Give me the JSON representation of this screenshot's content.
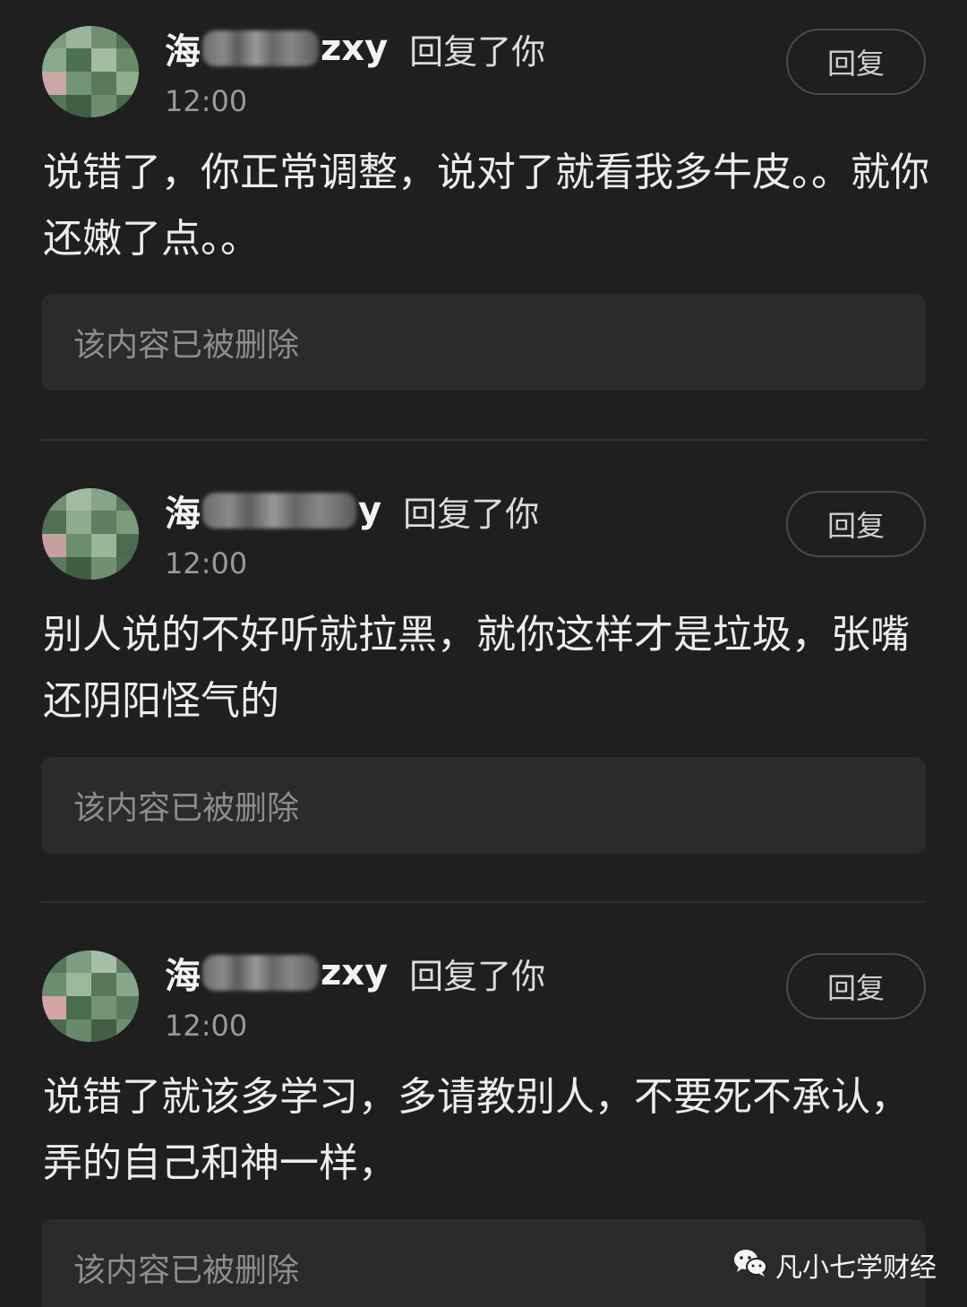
{
  "comments": [
    {
      "username_start": "海",
      "username_end": "zxy",
      "reply_to": "回复了你",
      "time": "12:00",
      "reply_button": "回复",
      "text": "说错了，你正常调整，说对了就看我多牛皮。。就你还嫩了点。。",
      "deleted_quote": "该内容已被删除"
    },
    {
      "username_start": "海",
      "username_end": "y",
      "reply_to": "回复了你",
      "time": "12:00",
      "reply_button": "回复",
      "text": "别人说的不好听就拉黑，就你这样才是垃圾，张嘴还阴阳怪气的",
      "deleted_quote": "该内容已被删除"
    },
    {
      "username_start": "海",
      "username_end": "zxy",
      "reply_to": "回复了你",
      "time": "12:00",
      "reply_button": "回复",
      "text": "说错了就该多学习，多请教别人，不要死不承认，弄的自己和神一样，",
      "deleted_quote": "该内容已被删除"
    }
  ],
  "watermark": {
    "icon": "wechat-icon",
    "text": "凡小七学财经"
  },
  "colors": {
    "background": "#1f1f1f",
    "deleted_box": "#2b2b2b",
    "muted_text": "#8d8d8d"
  }
}
